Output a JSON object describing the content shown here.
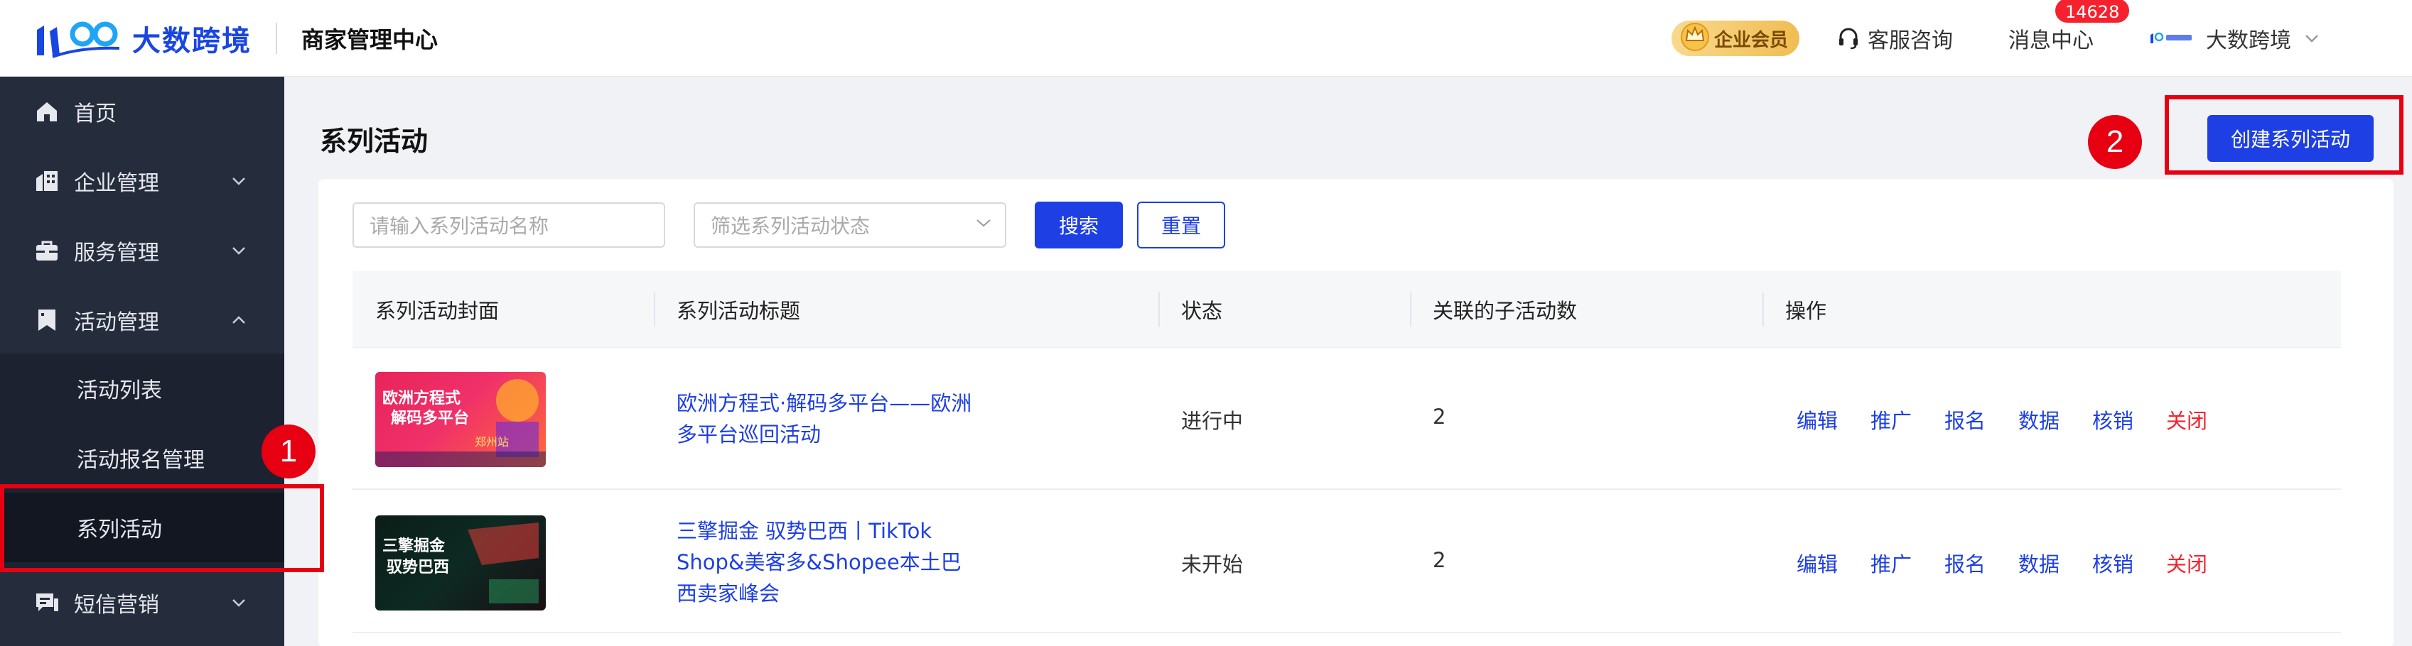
{
  "header": {
    "brand": "大数跨境",
    "title": "商家管理中心",
    "vip_label": "企业会员",
    "support_label": "客服咨询",
    "messages_label": "消息中心",
    "messages_count": "14628",
    "user_name": "大数跨境"
  },
  "sidebar": {
    "items": [
      {
        "label": "首页",
        "icon": "home-icon"
      },
      {
        "label": "企业管理",
        "icon": "building-icon"
      },
      {
        "label": "服务管理",
        "icon": "briefcase-icon"
      },
      {
        "label": "活动管理",
        "icon": "bookmark-icon"
      },
      {
        "label": "短信营销",
        "icon": "sms-icon"
      }
    ],
    "sub_items": [
      {
        "label": "活动列表"
      },
      {
        "label": "活动报名管理"
      },
      {
        "label": "系列活动"
      }
    ]
  },
  "main": {
    "title": "系列活动",
    "create_button": "创建系列活动",
    "search_placeholder": "请输入系列活动名称",
    "status_placeholder": "筛选系列活动状态",
    "search_button": "搜索",
    "reset_button": "重置"
  },
  "table": {
    "columns": [
      "系列活动封面",
      "系列活动标题",
      "状态",
      "关联的子活动数",
      "操作"
    ],
    "rows": [
      {
        "title_lines": [
          "欧洲方程式·解码多平台——欧洲",
          "多平台巡回活动"
        ],
        "status": "进行中",
        "sub_count": "2",
        "cover_text": [
          "欧洲方程式",
          "解码多平台",
          "郑州站"
        ]
      },
      {
        "title_lines": [
          "三擎掘金 驭势巴西丨TikTok",
          "Shop&美客多&Shopee本土巴",
          "西卖家峰会"
        ],
        "status": "未开始",
        "sub_count": "2",
        "cover_text": [
          "三擎掘金",
          "驭势巴西"
        ]
      }
    ],
    "actions": [
      "编辑",
      "推广",
      "报名",
      "数据",
      "核销",
      "关闭"
    ]
  },
  "annotations": [
    "1",
    "2"
  ],
  "colors": {
    "primary": "#1d3fe3",
    "sidebar_bg": "#252d3d",
    "danger": "#f5222d",
    "annotation_red": "#e60012"
  }
}
